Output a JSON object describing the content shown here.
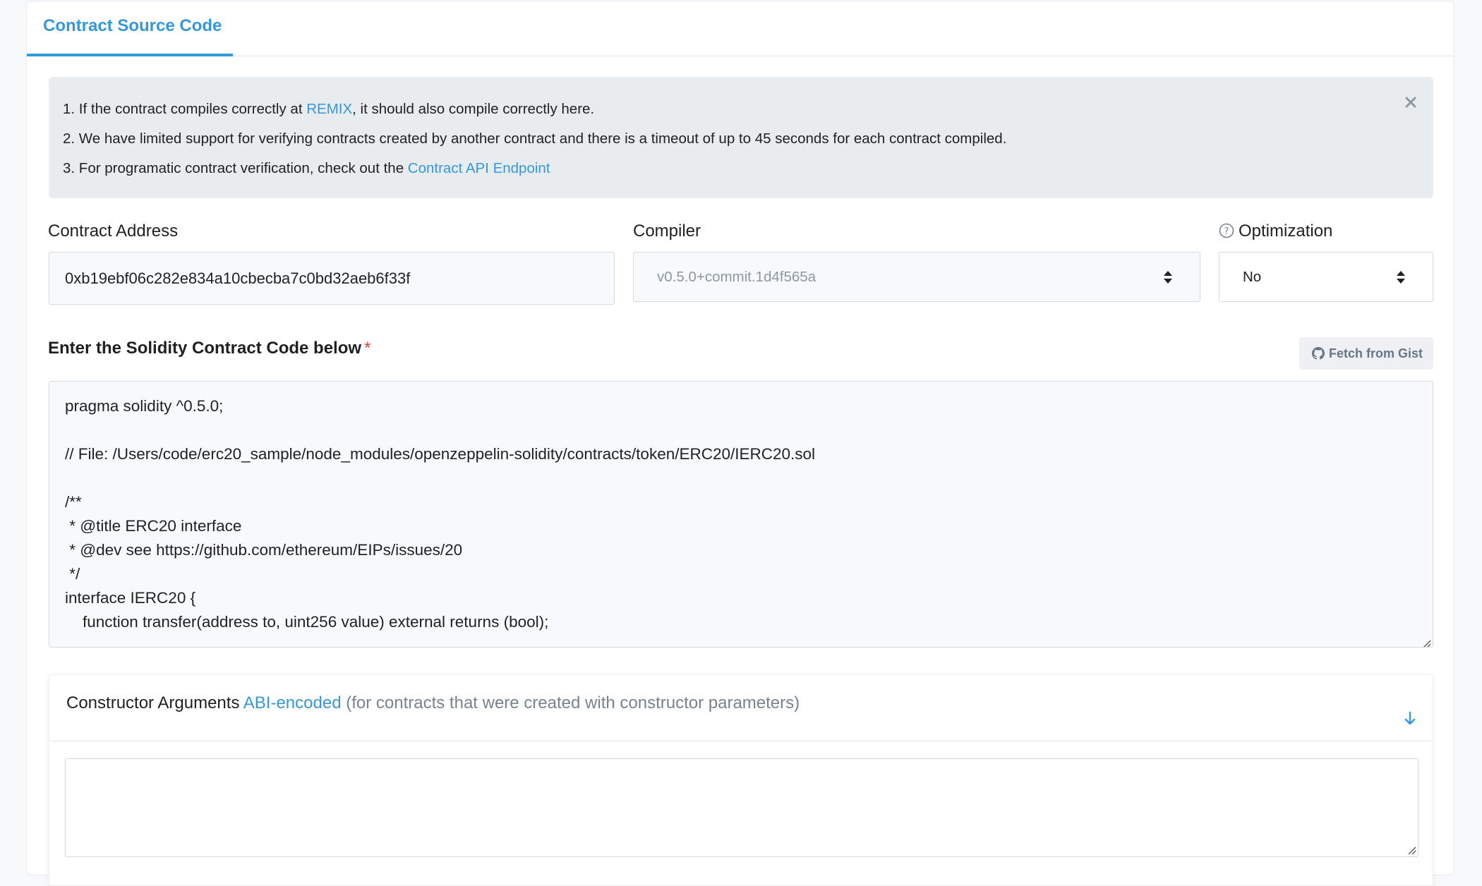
{
  "tab": {
    "label": "Contract Source Code"
  },
  "alert": {
    "line1_prefix": "1. If the contract compiles correctly at ",
    "line1_link": "REMIX",
    "line1_suffix": ", it should also compile correctly here.",
    "line2": "2. We have limited support for verifying contracts created by another contract and there is a timeout of up to 45 seconds for each contract compiled.",
    "line3_prefix": "3. For programatic contract verification, check out the ",
    "line3_link": "Contract API Endpoint",
    "close_icon": "close-icon"
  },
  "form": {
    "contract_address_label": "Contract Address",
    "contract_address_value": "0xb19ebf06c282e834a10cbecba7c0bd32aeb6f33f",
    "compiler_label": "Compiler",
    "compiler_value": "v0.5.0+commit.1d4f565a",
    "optimization_label": "Optimization",
    "optimization_value": "No"
  },
  "code_section": {
    "title": "Enter the Solidity Contract Code below",
    "required_mark": "*",
    "fetch_button": "Fetch from Gist",
    "lines": [
      "pragma solidity ^0.5.0;",
      "",
      "// File: /Users/code/erc20_sample/node_modules/openzeppelin-solidity/contracts/token/ERC20/IERC20.sol",
      "",
      "/**",
      " * @title ERC20 interface",
      " * @dev see https://github.com/ethereum/EIPs/issues/20",
      " */",
      "interface IERC20 {",
      "    function transfer(address to, uint256 value) external returns (bool);"
    ]
  },
  "constructor_args": {
    "prefix": "Constructor Arguments ",
    "link": "ABI-encoded",
    "suffix": " (for contracts that were created with constructor parameters)"
  },
  "colors": {
    "accent": "#3498db",
    "required": "#de4437",
    "alert_bg": "#e9ecef"
  }
}
